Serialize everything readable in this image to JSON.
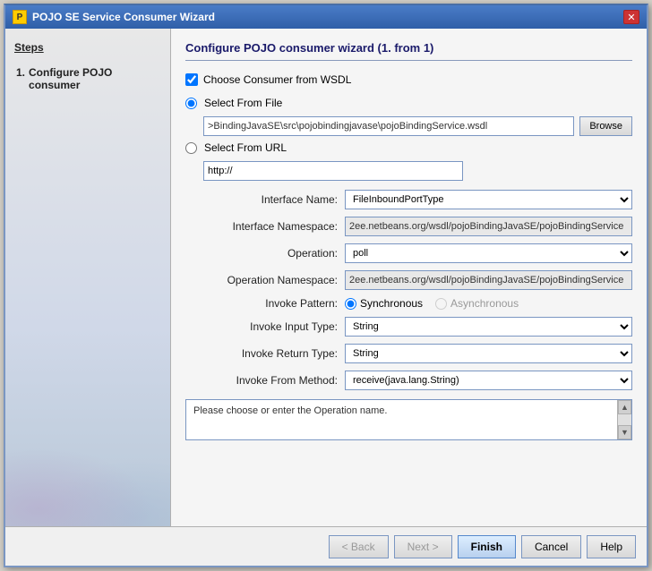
{
  "window": {
    "title": "POJO SE Service Consumer Wizard",
    "close_label": "✕"
  },
  "sidebar": {
    "heading": "Steps",
    "steps": [
      {
        "number": "1.",
        "label": "Configure POJO consumer",
        "active": true
      }
    ]
  },
  "panel": {
    "title": "Configure POJO consumer wizard (1. from 1)",
    "choose_from_wsdl_label": "Choose Consumer from WSDL",
    "select_from_file_label": "Select From File",
    "file_path": ">BindingJavaSE\\src\\pojobindingjavase\\pojoBindingService.wsdl",
    "browse_label": "Browse",
    "select_from_url_label": "Select From URL",
    "url_value": "http://",
    "interface_name_label": "Interface Name:",
    "interface_name_value": "FileInboundPortType",
    "interface_namespace_label": "Interface Namespace:",
    "interface_namespace_value": "2ee.netbeans.org/wsdl/pojoBindingJavaSE/pojoBindingService",
    "operation_label": "Operation:",
    "operation_value": "poll",
    "operation_namespace_label": "Operation Namespace:",
    "operation_namespace_value": "2ee.netbeans.org/wsdl/pojoBindingJavaSE/pojoBindingService",
    "invoke_pattern_label": "Invoke Pattern:",
    "synchronous_label": "Synchronous",
    "asynchronous_label": "Asynchronous",
    "invoke_input_label": "Invoke Input Type:",
    "invoke_input_value": "String",
    "invoke_return_label": "Invoke Return Type:",
    "invoke_return_value": "String",
    "invoke_from_label": "Invoke From Method:",
    "invoke_from_value": "receive(java.lang.String)",
    "message_text": "Please choose or enter the Operation name."
  },
  "footer": {
    "back_label": "< Back",
    "next_label": "Next >",
    "finish_label": "Finish",
    "cancel_label": "Cancel",
    "help_label": "Help"
  }
}
